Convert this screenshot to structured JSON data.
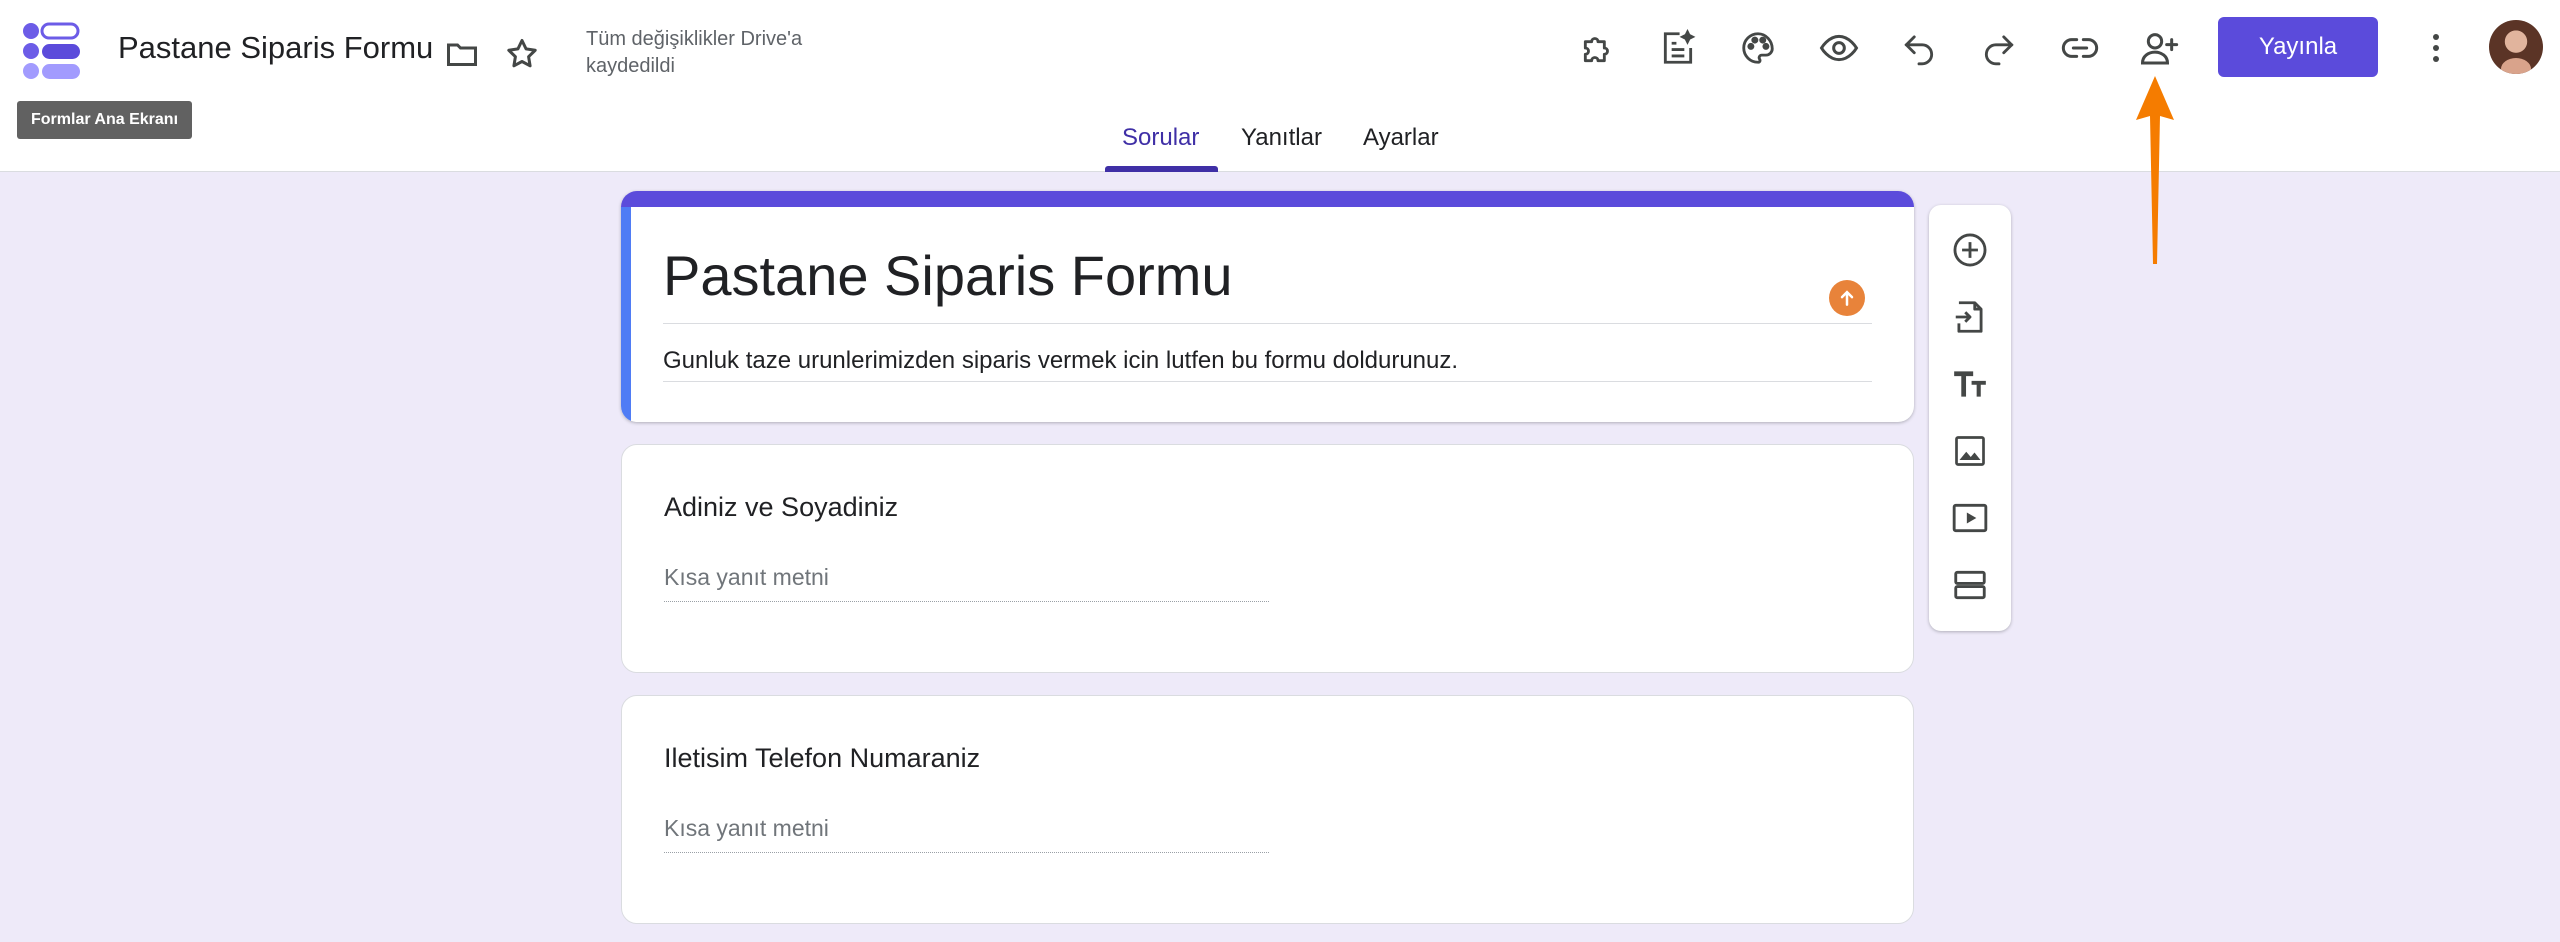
{
  "header": {
    "app_icon": "forms-logo-icon",
    "doc_title": "Pastane Siparis Formu",
    "save_status": "Tüm değişiklikler Drive'a kaydedildi",
    "tooltip": "Formlar Ana Ekranı",
    "icons": {
      "folder": "folder-icon",
      "star": "star-icon",
      "addons": "puzzle-icon",
      "ai_summary": "sparkle-list-icon",
      "theme": "palette-icon",
      "preview": "eye-icon",
      "undo": "undo-icon",
      "redo": "redo-icon",
      "link": "link-icon",
      "add_collaborator": "person-add-icon",
      "more": "more-vert-icon"
    },
    "publish_label": "Yayınla",
    "avatar": "user-avatar"
  },
  "tabs": [
    {
      "label": "Sorular",
      "active": true
    },
    {
      "label": "Yanıtlar",
      "active": false
    },
    {
      "label": "Ayarlar",
      "active": false
    }
  ],
  "form": {
    "title": "Pastane Siparis Formu",
    "description": "Gunluk taze urunlerimizden siparis vermek icin lutfen bu formu doldurunuz.",
    "questions": [
      {
        "title": "Adiniz ve Soyadiniz",
        "placeholder": "Kısa yanıt metni"
      },
      {
        "title": "Iletisim Telefon Numaraniz",
        "placeholder": "Kısa yanıt metni"
      }
    ]
  },
  "side_toolbar": {
    "icons": [
      "add-question-icon",
      "import-questions-icon",
      "add-title-icon",
      "add-image-icon",
      "add-video-icon",
      "add-section-icon"
    ]
  },
  "colors": {
    "brand": "#5b4bdb",
    "background": "#eeeaf9",
    "active_tab": "#3f2fa6",
    "annotation_arrow": "#f57c00"
  }
}
